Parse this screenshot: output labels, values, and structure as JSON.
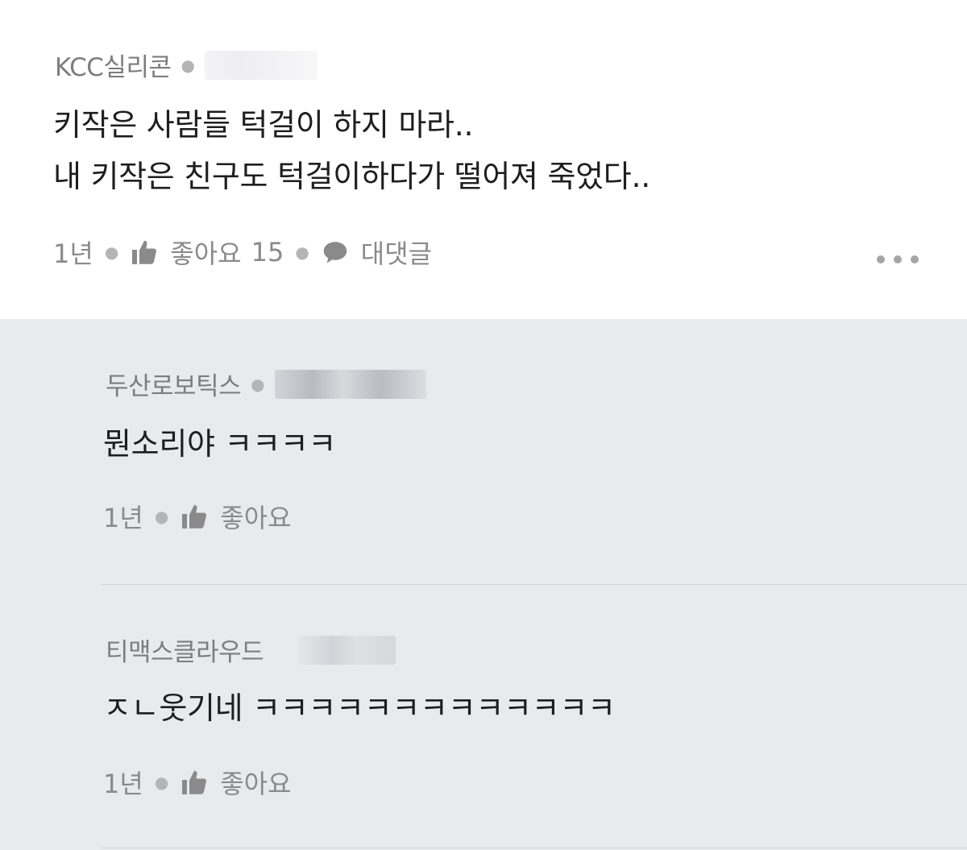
{
  "comment": {
    "author": "KCC실리콘",
    "text_line1": "키작은 사람들 턱걸이 하지 마라..",
    "text_line2": "내 키작은 친구도 턱걸이하다가 떨어져 죽었다..",
    "time": "1년",
    "like_label": "좋아요",
    "like_count": "15",
    "reply_label": "대댓글"
  },
  "replies": [
    {
      "author": "두산로보틱스",
      "text": "뭔소리야 ㅋㅋㅋㅋ",
      "time": "1년",
      "like_label": "좋아요"
    },
    {
      "author": "티맥스클라우드",
      "text": "ㅈㄴ웃기네 ㅋㅋㅋㅋㅋㅋㅋㅋㅋㅋㅋㅋㅋ",
      "time": "1년",
      "like_label": "좋아요"
    }
  ],
  "icons": {
    "like": "thumbs-up-icon",
    "reply": "speech-bubble-icon",
    "more": "more-dots-icon"
  },
  "colors": {
    "top_background": "#ffffff",
    "reply_background": "#e9eaee",
    "meta_text": "#8a8a8a",
    "author_text": "#7d7d7d",
    "body_text": "#1e1e1e"
  }
}
